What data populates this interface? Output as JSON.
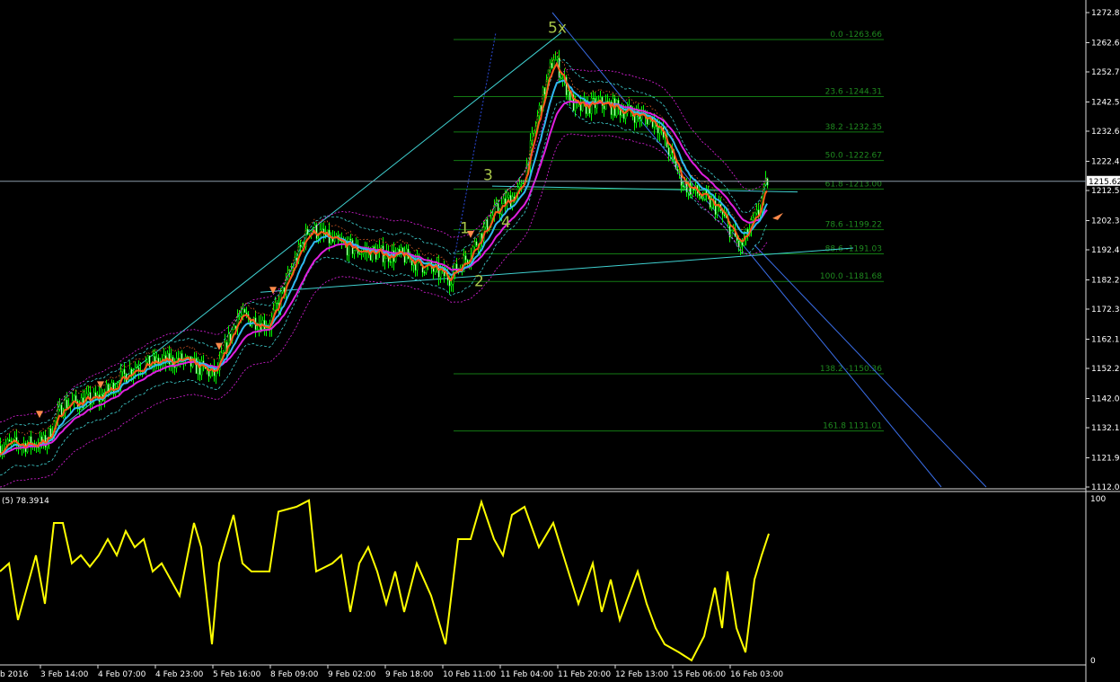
{
  "chart_data": {
    "type": "candlestick",
    "title_text": "",
    "price_axis": {
      "min": 1112.0,
      "max": 1272.8,
      "ticks": [
        "1272.80",
        "1262.60",
        "1252.70",
        "1242.50",
        "1232.60",
        "1222.40",
        "1212.50",
        "1202.30",
        "1192.40",
        "1182.20",
        "1172.30",
        "1162.10",
        "1152.20",
        "1142.00",
        "1132.10",
        "1121.90",
        "1112.00"
      ]
    },
    "current_price": "1215.62",
    "current_price_value": 1215.62,
    "time_axis": [
      "b 2016",
      "3 Feb 14:00",
      "4 Feb 07:00",
      "4 Feb 23:00",
      "5 Feb 16:00",
      "8 Feb 09:00",
      "9 Feb 02:00",
      "9 Feb 18:00",
      "10 Feb 11:00",
      "11 Feb 04:00",
      "11 Feb 20:00",
      "12 Feb 13:00",
      "15 Feb 06:00",
      "16 Feb 03:00"
    ],
    "close_waypoints": [
      [
        0,
        1126
      ],
      [
        25,
        1127
      ],
      [
        35,
        1140
      ],
      [
        55,
        1142
      ],
      [
        75,
        1153
      ],
      [
        100,
        1155
      ],
      [
        120,
        1150
      ],
      [
        132,
        1170
      ],
      [
        150,
        1167
      ],
      [
        165,
        1190
      ],
      [
        172,
        1200
      ],
      [
        185,
        1195
      ],
      [
        200,
        1192
      ],
      [
        225,
        1190
      ],
      [
        250,
        1183
      ],
      [
        260,
        1190
      ],
      [
        275,
        1205
      ],
      [
        290,
        1213
      ],
      [
        300,
        1240
      ],
      [
        308,
        1258
      ],
      [
        320,
        1240
      ],
      [
        335,
        1242
      ],
      [
        365,
        1236
      ],
      [
        380,
        1215
      ],
      [
        400,
        1206
      ],
      [
        412,
        1193
      ],
      [
        422,
        1205
      ],
      [
        427,
        1216
      ]
    ],
    "fibonacci": [
      {
        "label": "0.0 -1263.66",
        "level": 1263.66
      },
      {
        "label": "23.6 -1244.31",
        "level": 1244.31
      },
      {
        "label": "38.2 -1232.35",
        "level": 1232.35
      },
      {
        "label": "50.0 -1222.67",
        "level": 1222.67
      },
      {
        "label": "61.8 -1213.00",
        "level": 1213.0
      },
      {
        "label": "78.6 -1199.22",
        "level": 1199.22
      },
      {
        "label": "88.6 -1191.03",
        "level": 1191.03
      },
      {
        "label": "100.0 -1181.68",
        "level": 1181.68
      },
      {
        "label": "138.2  -1150.36",
        "level": 1150.36
      },
      {
        "label": "161.8 1131.01",
        "level": 1131.01
      }
    ],
    "wave_labels": [
      {
        "text": "5x",
        "bar": 308,
        "price": 1266
      },
      {
        "text": "3",
        "bar": 272,
        "price": 1216
      },
      {
        "text": "1",
        "bar": 259,
        "price": 1198
      },
      {
        "text": "2",
        "bar": 267,
        "price": 1180
      },
      {
        "text": "4",
        "bar": 282,
        "price": 1200
      }
    ],
    "oscillator": {
      "label": "(5) 78.3914",
      "max_label": "100",
      "min_label": "0",
      "waypoints": [
        [
          0,
          55
        ],
        [
          5,
          60
        ],
        [
          10,
          25
        ],
        [
          15,
          45
        ],
        [
          20,
          65
        ],
        [
          25,
          35
        ],
        [
          30,
          85
        ],
        [
          35,
          85
        ],
        [
          40,
          60
        ],
        [
          45,
          65
        ],
        [
          50,
          58
        ],
        [
          55,
          65
        ],
        [
          60,
          75
        ],
        [
          65,
          65
        ],
        [
          70,
          80
        ],
        [
          75,
          70
        ],
        [
          80,
          75
        ],
        [
          85,
          55
        ],
        [
          90,
          60
        ],
        [
          100,
          40
        ],
        [
          108,
          85
        ],
        [
          112,
          70
        ],
        [
          118,
          10
        ],
        [
          122,
          60
        ],
        [
          130,
          90
        ],
        [
          135,
          60
        ],
        [
          140,
          55
        ],
        [
          150,
          55
        ],
        [
          155,
          92
        ],
        [
          165,
          95
        ],
        [
          172,
          99
        ],
        [
          176,
          55
        ],
        [
          185,
          60
        ],
        [
          190,
          65
        ],
        [
          195,
          30
        ],
        [
          200,
          60
        ],
        [
          205,
          70
        ],
        [
          210,
          55
        ],
        [
          215,
          35
        ],
        [
          220,
          55
        ],
        [
          225,
          30
        ],
        [
          232,
          60
        ],
        [
          240,
          40
        ],
        [
          248,
          10
        ],
        [
          255,
          75
        ],
        [
          262,
          75
        ],
        [
          268,
          98
        ],
        [
          275,
          75
        ],
        [
          280,
          65
        ],
        [
          285,
          90
        ],
        [
          292,
          95
        ],
        [
          300,
          70
        ],
        [
          308,
          85
        ],
        [
          315,
          60
        ],
        [
          322,
          35
        ],
        [
          330,
          60
        ],
        [
          335,
          30
        ],
        [
          340,
          50
        ],
        [
          345,
          25
        ],
        [
          355,
          55
        ],
        [
          360,
          35
        ],
        [
          365,
          20
        ],
        [
          370,
          10
        ],
        [
          378,
          5
        ],
        [
          385,
          0
        ],
        [
          392,
          15
        ],
        [
          398,
          45
        ],
        [
          402,
          20
        ],
        [
          405,
          55
        ],
        [
          410,
          20
        ],
        [
          415,
          5
        ],
        [
          420,
          50
        ],
        [
          424,
          65
        ],
        [
          428,
          78.39
        ]
      ]
    }
  }
}
